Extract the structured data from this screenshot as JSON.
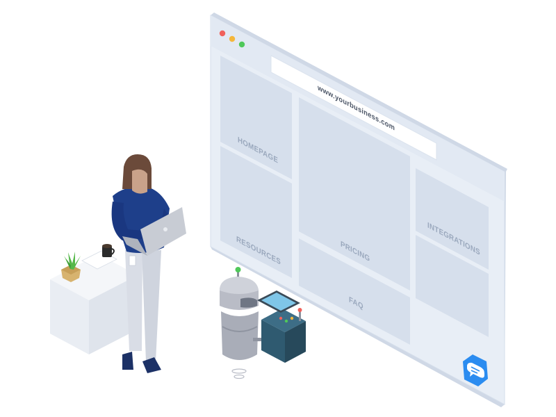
{
  "browser": {
    "url": "www.yourbusiness.com",
    "dots": [
      "#f0615b",
      "#f5b73b",
      "#4fc85a"
    ],
    "tiles": {
      "homepage": "HOMEPAGE",
      "resources": "RESOURCES",
      "pricing": "PRICING",
      "faq": "FAQ",
      "integrations": "INTEGRATIONS"
    },
    "chat_icon": "chat-bubble-icon"
  },
  "colors": {
    "frame": "#e6ecf5",
    "tile": "#d6dfec",
    "label": "#9aa8bd",
    "chat": "#2b8cf0",
    "shirt": "#1e3f8a",
    "robot": "#b9bcc6"
  }
}
